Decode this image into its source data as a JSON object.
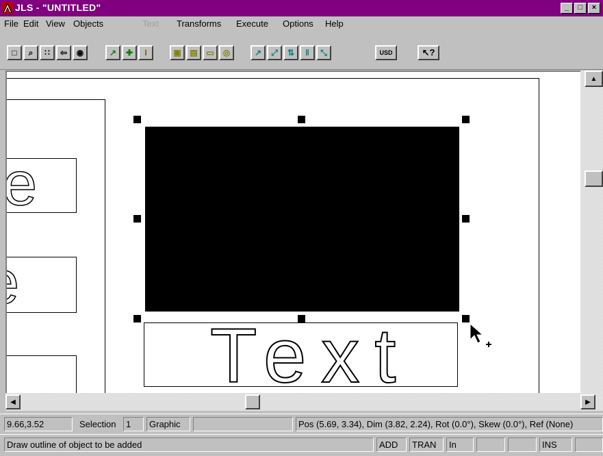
{
  "window": {
    "title": "JLS - \"UNTITLED\"",
    "minimize": "_",
    "maximize": "□",
    "close": "×"
  },
  "menu": [
    "File",
    "Edit",
    "View",
    "Objects",
    "Text",
    "Transforms",
    "Execute",
    "Options",
    "Help"
  ],
  "toolbar": {
    "buttons": [
      {
        "name": "select-tool",
        "icon": "□"
      },
      {
        "name": "zoom-tool",
        "icon": "⌕"
      },
      {
        "name": "grid-tool",
        "icon": "∷"
      },
      {
        "name": "back-tool",
        "icon": "⇦"
      },
      {
        "name": "view-tool",
        "icon": "◉"
      },
      {
        "name": "arrow-tool",
        "icon": "↗"
      },
      {
        "name": "add-tool",
        "icon": "✚"
      },
      {
        "name": "text-cursor-tool",
        "icon": "I"
      },
      {
        "name": "object1-tool",
        "icon": "▣"
      },
      {
        "name": "object2-tool",
        "icon": "▤"
      },
      {
        "name": "object3-tool",
        "icon": "▭"
      },
      {
        "name": "object4-tool",
        "icon": "◎"
      },
      {
        "name": "transform1-tool",
        "icon": "↗"
      },
      {
        "name": "transform2-tool",
        "icon": "⤢"
      },
      {
        "name": "transform3-tool",
        "icon": "⇅"
      },
      {
        "name": "transform4-tool",
        "icon": "‖"
      },
      {
        "name": "transform5-tool",
        "icon": "⤡"
      }
    ],
    "usd_label": "USD",
    "help_icon": "↖?"
  },
  "canvas": {
    "left_letters": [
      "e",
      "e"
    ],
    "text_object": "Text"
  },
  "status1": {
    "coords": "9.66,3.52",
    "selection_label": "Selection",
    "selection_count": "1",
    "object_type": "Graphic",
    "blank": "",
    "info": "Pos (5.69, 3.34), Dim (3.82, 2.24), Rot (0.0°), Skew (0.0°), Ref (None)"
  },
  "status2": {
    "hint": "Draw outline of object to be added",
    "mode_add": "ADD",
    "mode_tran": "TRAN",
    "units": "In",
    "ins": "INS"
  }
}
